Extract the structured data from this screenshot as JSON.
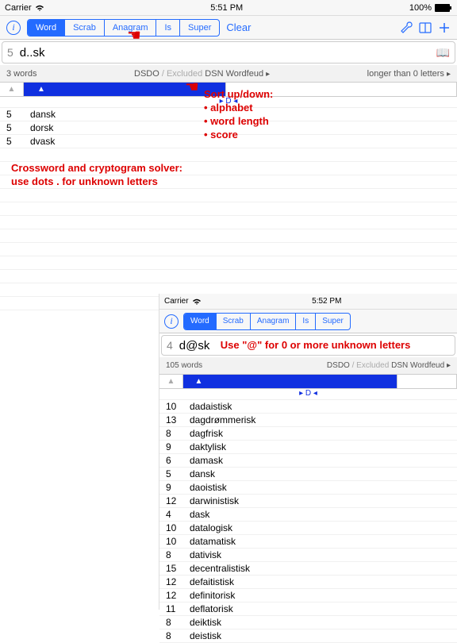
{
  "status": {
    "carrier": "Carrier",
    "time": "5:51 PM",
    "batt": "100%"
  },
  "segments": [
    "Word",
    "Scrab",
    "Anagram",
    "Is",
    "Super"
  ],
  "clear": "Clear",
  "search": {
    "count": "5",
    "query": "d..sk"
  },
  "meta": {
    "wordcount": "3 words",
    "src1": "DSDO",
    "exc": "/ Excluded",
    "src2": "DSN",
    "src3": "Wordfeud",
    "right": "longer than 0 letters"
  },
  "letter": "▸ D ◂",
  "rows": [
    {
      "n": "5",
      "w": "dansk"
    },
    {
      "n": "5",
      "w": "dorsk"
    },
    {
      "n": "5",
      "w": "dvask"
    }
  ],
  "anno1": "Sort up/down:\n• alphabet\n• word length\n• score",
  "anno2": "Crossword and cryptogram solver:\nuse dots . for unknown letters",
  "nested": {
    "status": {
      "carrier": "Carrier",
      "time": "5:52 PM"
    },
    "search": {
      "count": "4",
      "query": "d@sk"
    },
    "hint": "Use \"@\" for 0 or more unknown letters",
    "meta": {
      "wordcount": "105 words",
      "src1": "DSDO",
      "exc": "/ Excluded",
      "src2": "DSN",
      "src3": "Wordfeud"
    },
    "letter": "▸ D ◂",
    "rows": [
      {
        "n": "10",
        "w": "dadaistisk"
      },
      {
        "n": "13",
        "w": "dagdrømmerisk"
      },
      {
        "n": "8",
        "w": "dagfrisk"
      },
      {
        "n": "9",
        "w": "daktylisk"
      },
      {
        "n": "6",
        "w": "damask"
      },
      {
        "n": "5",
        "w": "dansk"
      },
      {
        "n": "9",
        "w": "daoistisk"
      },
      {
        "n": "12",
        "w": "darwinistisk"
      },
      {
        "n": "4",
        "w": "dask"
      },
      {
        "n": "10",
        "w": "datalogisk"
      },
      {
        "n": "10",
        "w": "datamatisk"
      },
      {
        "n": "8",
        "w": "dativisk"
      },
      {
        "n": "15",
        "w": "decentralistisk"
      },
      {
        "n": "12",
        "w": "defaitistisk"
      },
      {
        "n": "12",
        "w": "definitorisk"
      },
      {
        "n": "11",
        "w": "deflatorisk"
      },
      {
        "n": "8",
        "w": "deiktisk"
      },
      {
        "n": "8",
        "w": "deistisk"
      }
    ]
  }
}
